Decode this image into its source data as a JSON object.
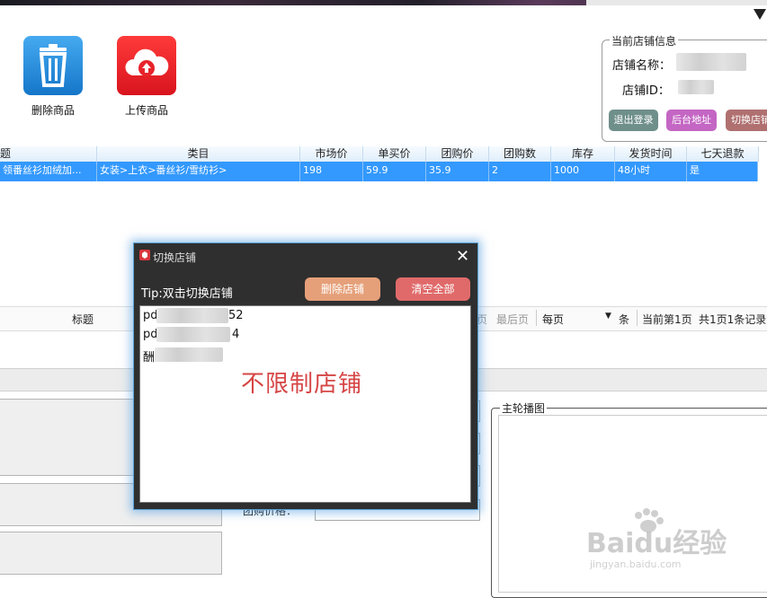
{
  "toolbar": {
    "delete_label": "删除商品",
    "upload_label": "上传商品"
  },
  "store_info": {
    "legend": "当前店铺信息",
    "name_label": "店铺名称：",
    "id_label": "店铺ID：",
    "logout_label": "退出登录",
    "backend_label": "后台地址",
    "switch_label": "切换店铺"
  },
  "table": {
    "headers": [
      "题",
      "类目",
      "市场价",
      "单买价",
      "团购价",
      "团购数",
      "库存",
      "发货时间",
      "七天退款"
    ],
    "rows": [
      [
        "领番丝衫加绒加...",
        "女装>上衣>番丝衫/雪纺衫>",
        "198",
        "59.9",
        "35.9",
        "2",
        "1000",
        "48小时",
        "是"
      ]
    ]
  },
  "lower": {
    "title_label": "标题",
    "page_prev_partial": "页",
    "last_page": "最后页",
    "per_page": "每页",
    "unit": "条",
    "current_page": "当前第1页",
    "total": "共1页1条记录",
    "group_price_label": "团购价格：",
    "slideshow_legend": "主轮播图"
  },
  "dialog": {
    "title": "切换店铺",
    "tip": "Tip:双击切换店铺",
    "delete_store": "删除店铺",
    "clear_all": "清空全部",
    "stores": [
      {
        "prefix": "pd",
        "suffix": "52"
      },
      {
        "prefix": "pd",
        "suffix": "4"
      },
      {
        "prefix": "酬",
        "suffix": ""
      }
    ],
    "unlimited_text": "不限制店铺"
  },
  "watermark": {
    "brand": "Baidu经验",
    "url": "jingyan.baidu.com"
  },
  "colors": {
    "delete_icon_bg": "#1e8fdc",
    "upload_icon_bg": "#e8232b",
    "row_selected": "#3399ff",
    "logout_btn": "#6f8f8b",
    "backend_btn": "#c466c4",
    "switch_btn": "#b07070",
    "delete_store_btn": "#e5a07a",
    "clear_all_btn": "#e06a6a"
  }
}
